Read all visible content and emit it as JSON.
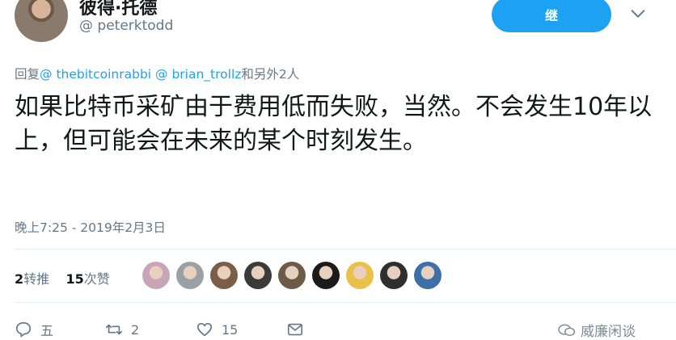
{
  "author": {
    "display_name": "彼得·托德",
    "handle": "@ peterktodd"
  },
  "follow_button": {
    "label": "继"
  },
  "reply_to": {
    "prefix": "回复",
    "user1": "@ thebitcoinrabbi",
    "user2": "@ brian_trollz",
    "suffix": "和另外2人"
  },
  "tweet": {
    "text": "如果比特币采矿由于费用低而失败，当然。不会发生10年以上，但可能会在未来的某个时刻发生。",
    "timestamp": "晚上7:25 - 2019年2月3日"
  },
  "stats": {
    "retweets_count": "2",
    "retweets_label": "转推",
    "likes_count": "15",
    "likes_label": "次赞"
  },
  "likers": [
    "#c9a3b8",
    "#9aa0a6",
    "#7b5d4a",
    "#3b3a3a",
    "#6e5a48",
    "#1b1b1b",
    "#e9c14a",
    "#2f2f2f",
    "#3d6fa8"
  ],
  "actions": {
    "reply_count": "五",
    "retweet_count": "2",
    "like_count": "15"
  },
  "watermark": {
    "text": "威廉闲谈"
  },
  "colors": {
    "accent": "#1da1f2",
    "muted": "#657786"
  }
}
